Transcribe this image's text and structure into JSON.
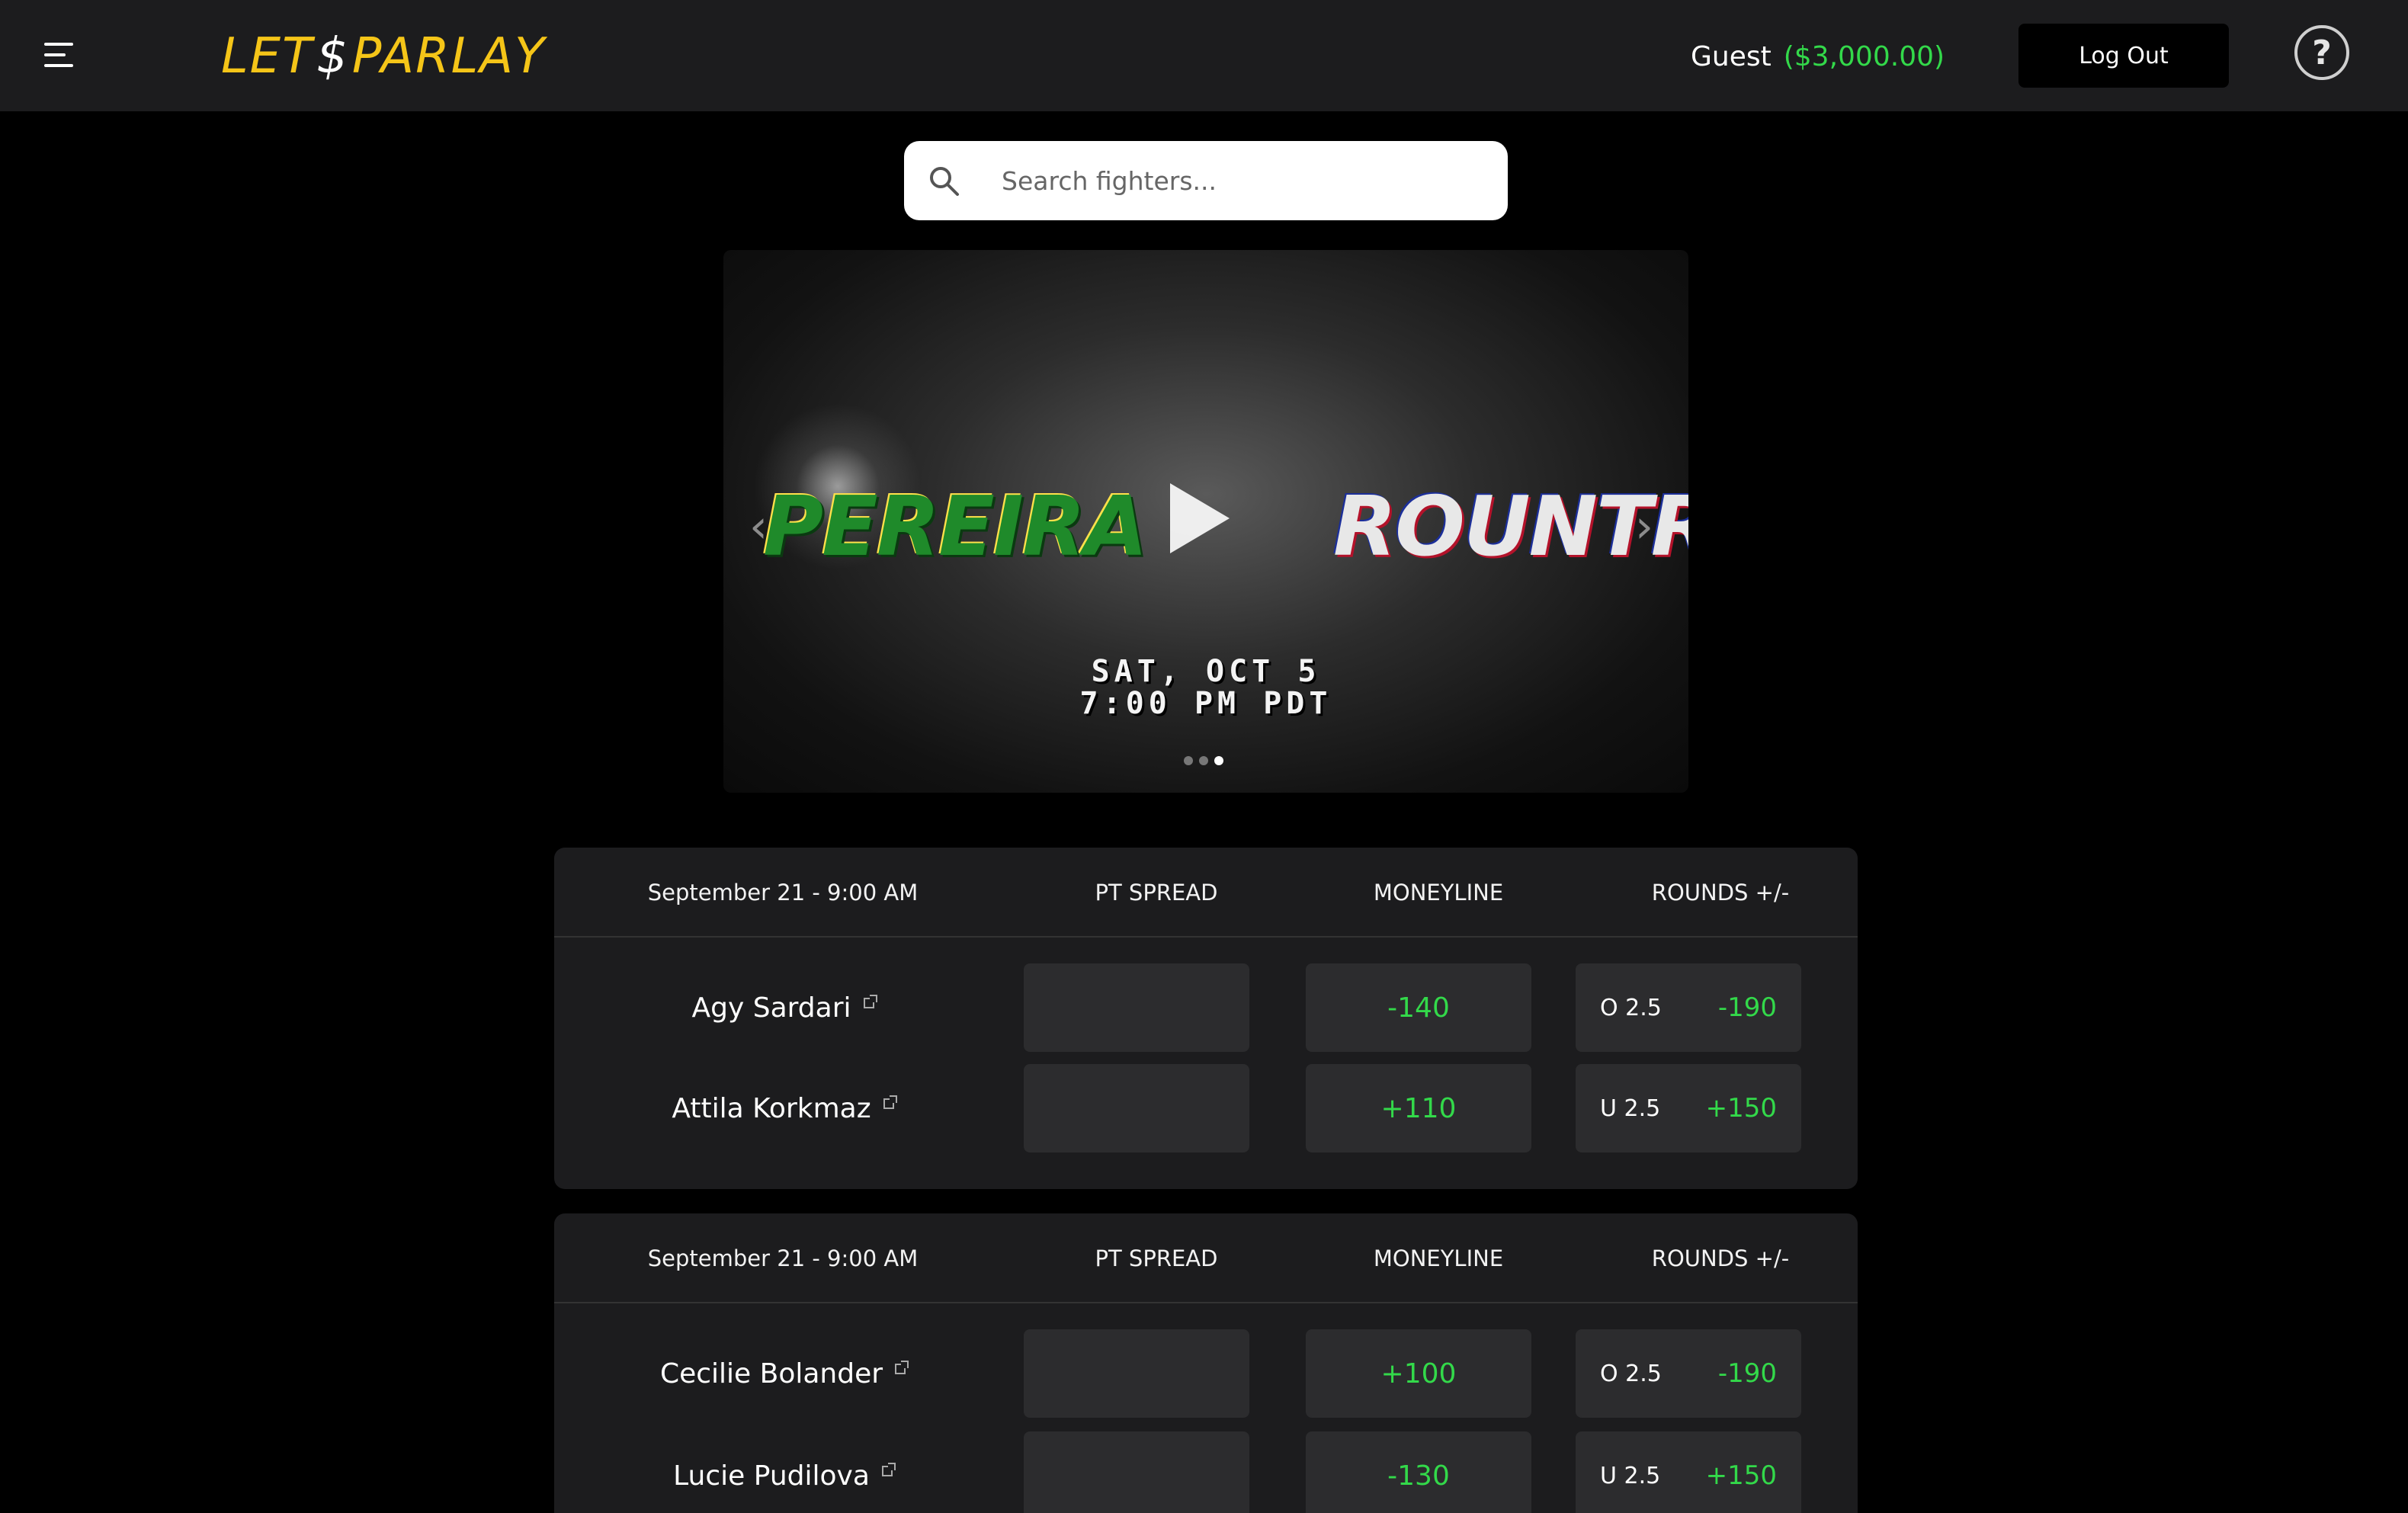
{
  "header": {
    "logo_left": "LET",
    "logo_symbol": "$",
    "logo_right": "PARLAY",
    "user_name": "Guest",
    "balance": "($3,000.00)",
    "logout_label": "Log Out",
    "help_label": "?"
  },
  "search": {
    "placeholder": "Search fighters..."
  },
  "banner": {
    "fighter_left": "PEREIRA",
    "fighter_right": "ROUNTREE",
    "date_line_1": "SAT, OCT 5",
    "date_line_2": "7:00 PM PDT",
    "slide_count": 3,
    "active_slide": 3
  },
  "cards": [
    {
      "date": "September 21 - 9:00 AM",
      "col_spread": "PT SPREAD",
      "col_moneyline": "MONEYLINE",
      "col_rounds": "ROUNDS +/-",
      "fighters": [
        {
          "name": "Agy Sardari",
          "spread": "",
          "moneyline": "-140",
          "rounds_line": "O 2.5",
          "rounds_price": "-190"
        },
        {
          "name": "Attila Korkmaz",
          "spread": "",
          "moneyline": "+110",
          "rounds_line": "U 2.5",
          "rounds_price": "+150"
        }
      ]
    },
    {
      "date": "September 21 - 9:00 AM",
      "col_spread": "PT SPREAD",
      "col_moneyline": "MONEYLINE",
      "col_rounds": "ROUNDS +/-",
      "fighters": [
        {
          "name": "Cecilie Bolander",
          "spread": "",
          "moneyline": "+100",
          "rounds_line": "O 2.5",
          "rounds_price": "-190"
        },
        {
          "name": "Lucie Pudilova",
          "spread": "",
          "moneyline": "-130",
          "rounds_line": "U 2.5",
          "rounds_price": "+150"
        }
      ]
    }
  ],
  "colors": {
    "accent_gold": "#f5c518",
    "odds_green": "#33d94a",
    "panel": "#1c1c1e",
    "odds_button": "#2c2c2e"
  }
}
